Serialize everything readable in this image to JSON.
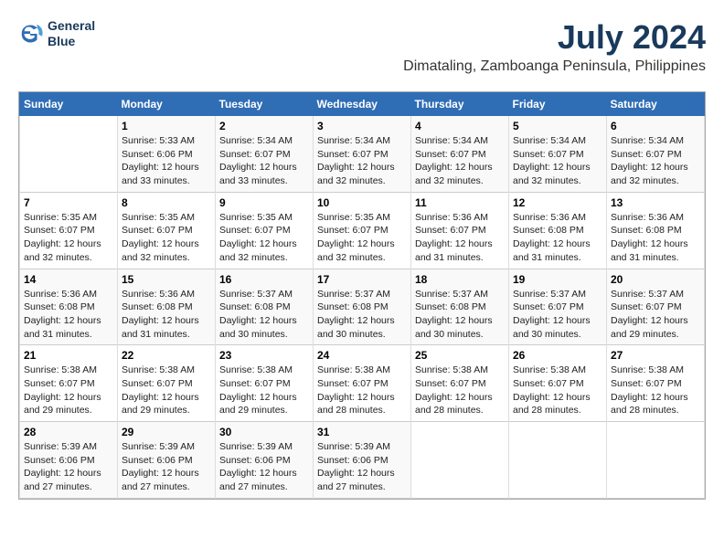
{
  "header": {
    "logo_line1": "General",
    "logo_line2": "Blue",
    "month_year": "July 2024",
    "location": "Dimataling, Zamboanga Peninsula, Philippines"
  },
  "days_of_week": [
    "Sunday",
    "Monday",
    "Tuesday",
    "Wednesday",
    "Thursday",
    "Friday",
    "Saturday"
  ],
  "weeks": [
    [
      {
        "day": "",
        "sunrise": "",
        "sunset": "",
        "daylight": ""
      },
      {
        "day": "1",
        "sunrise": "Sunrise: 5:33 AM",
        "sunset": "Sunset: 6:06 PM",
        "daylight": "Daylight: 12 hours and 33 minutes."
      },
      {
        "day": "2",
        "sunrise": "Sunrise: 5:34 AM",
        "sunset": "Sunset: 6:07 PM",
        "daylight": "Daylight: 12 hours and 33 minutes."
      },
      {
        "day": "3",
        "sunrise": "Sunrise: 5:34 AM",
        "sunset": "Sunset: 6:07 PM",
        "daylight": "Daylight: 12 hours and 32 minutes."
      },
      {
        "day": "4",
        "sunrise": "Sunrise: 5:34 AM",
        "sunset": "Sunset: 6:07 PM",
        "daylight": "Daylight: 12 hours and 32 minutes."
      },
      {
        "day": "5",
        "sunrise": "Sunrise: 5:34 AM",
        "sunset": "Sunset: 6:07 PM",
        "daylight": "Daylight: 12 hours and 32 minutes."
      },
      {
        "day": "6",
        "sunrise": "Sunrise: 5:34 AM",
        "sunset": "Sunset: 6:07 PM",
        "daylight": "Daylight: 12 hours and 32 minutes."
      }
    ],
    [
      {
        "day": "7",
        "sunrise": "Sunrise: 5:35 AM",
        "sunset": "Sunset: 6:07 PM",
        "daylight": "Daylight: 12 hours and 32 minutes."
      },
      {
        "day": "8",
        "sunrise": "Sunrise: 5:35 AM",
        "sunset": "Sunset: 6:07 PM",
        "daylight": "Daylight: 12 hours and 32 minutes."
      },
      {
        "day": "9",
        "sunrise": "Sunrise: 5:35 AM",
        "sunset": "Sunset: 6:07 PM",
        "daylight": "Daylight: 12 hours and 32 minutes."
      },
      {
        "day": "10",
        "sunrise": "Sunrise: 5:35 AM",
        "sunset": "Sunset: 6:07 PM",
        "daylight": "Daylight: 12 hours and 32 minutes."
      },
      {
        "day": "11",
        "sunrise": "Sunrise: 5:36 AM",
        "sunset": "Sunset: 6:07 PM",
        "daylight": "Daylight: 12 hours and 31 minutes."
      },
      {
        "day": "12",
        "sunrise": "Sunrise: 5:36 AM",
        "sunset": "Sunset: 6:08 PM",
        "daylight": "Daylight: 12 hours and 31 minutes."
      },
      {
        "day": "13",
        "sunrise": "Sunrise: 5:36 AM",
        "sunset": "Sunset: 6:08 PM",
        "daylight": "Daylight: 12 hours and 31 minutes."
      }
    ],
    [
      {
        "day": "14",
        "sunrise": "Sunrise: 5:36 AM",
        "sunset": "Sunset: 6:08 PM",
        "daylight": "Daylight: 12 hours and 31 minutes."
      },
      {
        "day": "15",
        "sunrise": "Sunrise: 5:36 AM",
        "sunset": "Sunset: 6:08 PM",
        "daylight": "Daylight: 12 hours and 31 minutes."
      },
      {
        "day": "16",
        "sunrise": "Sunrise: 5:37 AM",
        "sunset": "Sunset: 6:08 PM",
        "daylight": "Daylight: 12 hours and 30 minutes."
      },
      {
        "day": "17",
        "sunrise": "Sunrise: 5:37 AM",
        "sunset": "Sunset: 6:08 PM",
        "daylight": "Daylight: 12 hours and 30 minutes."
      },
      {
        "day": "18",
        "sunrise": "Sunrise: 5:37 AM",
        "sunset": "Sunset: 6:08 PM",
        "daylight": "Daylight: 12 hours and 30 minutes."
      },
      {
        "day": "19",
        "sunrise": "Sunrise: 5:37 AM",
        "sunset": "Sunset: 6:07 PM",
        "daylight": "Daylight: 12 hours and 30 minutes."
      },
      {
        "day": "20",
        "sunrise": "Sunrise: 5:37 AM",
        "sunset": "Sunset: 6:07 PM",
        "daylight": "Daylight: 12 hours and 29 minutes."
      }
    ],
    [
      {
        "day": "21",
        "sunrise": "Sunrise: 5:38 AM",
        "sunset": "Sunset: 6:07 PM",
        "daylight": "Daylight: 12 hours and 29 minutes."
      },
      {
        "day": "22",
        "sunrise": "Sunrise: 5:38 AM",
        "sunset": "Sunset: 6:07 PM",
        "daylight": "Daylight: 12 hours and 29 minutes."
      },
      {
        "day": "23",
        "sunrise": "Sunrise: 5:38 AM",
        "sunset": "Sunset: 6:07 PM",
        "daylight": "Daylight: 12 hours and 29 minutes."
      },
      {
        "day": "24",
        "sunrise": "Sunrise: 5:38 AM",
        "sunset": "Sunset: 6:07 PM",
        "daylight": "Daylight: 12 hours and 28 minutes."
      },
      {
        "day": "25",
        "sunrise": "Sunrise: 5:38 AM",
        "sunset": "Sunset: 6:07 PM",
        "daylight": "Daylight: 12 hours and 28 minutes."
      },
      {
        "day": "26",
        "sunrise": "Sunrise: 5:38 AM",
        "sunset": "Sunset: 6:07 PM",
        "daylight": "Daylight: 12 hours and 28 minutes."
      },
      {
        "day": "27",
        "sunrise": "Sunrise: 5:38 AM",
        "sunset": "Sunset: 6:07 PM",
        "daylight": "Daylight: 12 hours and 28 minutes."
      }
    ],
    [
      {
        "day": "28",
        "sunrise": "Sunrise: 5:39 AM",
        "sunset": "Sunset: 6:06 PM",
        "daylight": "Daylight: 12 hours and 27 minutes."
      },
      {
        "day": "29",
        "sunrise": "Sunrise: 5:39 AM",
        "sunset": "Sunset: 6:06 PM",
        "daylight": "Daylight: 12 hours and 27 minutes."
      },
      {
        "day": "30",
        "sunrise": "Sunrise: 5:39 AM",
        "sunset": "Sunset: 6:06 PM",
        "daylight": "Daylight: 12 hours and 27 minutes."
      },
      {
        "day": "31",
        "sunrise": "Sunrise: 5:39 AM",
        "sunset": "Sunset: 6:06 PM",
        "daylight": "Daylight: 12 hours and 27 minutes."
      },
      {
        "day": "",
        "sunrise": "",
        "sunset": "",
        "daylight": ""
      },
      {
        "day": "",
        "sunrise": "",
        "sunset": "",
        "daylight": ""
      },
      {
        "day": "",
        "sunrise": "",
        "sunset": "",
        "daylight": ""
      }
    ]
  ]
}
